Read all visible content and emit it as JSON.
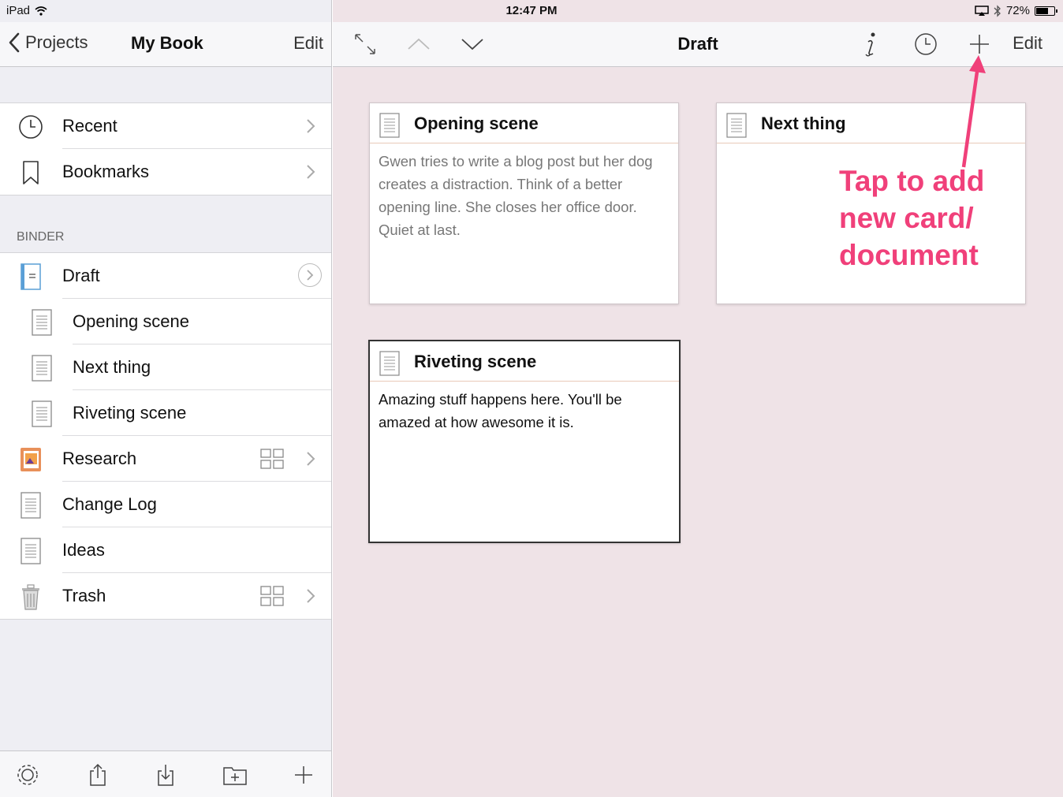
{
  "status": {
    "device": "iPad",
    "time": "12:47 PM",
    "battery": "72%",
    "battery_level": 0.72
  },
  "sidebar": {
    "back_label": "Projects",
    "title": "My Book",
    "edit_label": "Edit",
    "top_items": [
      {
        "label": "Recent",
        "icon": "clock-icon"
      },
      {
        "label": "Bookmarks",
        "icon": "bookmark-icon"
      }
    ],
    "binder_header": "BINDER",
    "binder_items": [
      {
        "label": "Draft",
        "icon": "draft-folder-icon"
      },
      {
        "label": "Opening scene",
        "icon": "document-icon"
      },
      {
        "label": "Next thing",
        "icon": "document-icon"
      },
      {
        "label": "Riveting scene",
        "icon": "document-icon"
      },
      {
        "label": "Research",
        "icon": "research-folder-icon"
      },
      {
        "label": "Change Log",
        "icon": "document-icon"
      },
      {
        "label": "Ideas",
        "icon": "document-icon"
      },
      {
        "label": "Trash",
        "icon": "trash-icon"
      }
    ],
    "toolbar": [
      "settings-gear-icon",
      "share-icon",
      "import-icon",
      "new-folder-icon",
      "add-icon"
    ]
  },
  "main": {
    "title": "Draft",
    "edit_label": "Edit",
    "nav_icons": [
      "expand-icon",
      "chevron-up-icon",
      "chevron-down-icon",
      "info-icon",
      "history-clock-icon",
      "add-icon"
    ],
    "cards": [
      {
        "title": "Opening scene",
        "synopsis": "Gwen tries to write a blog post but her dog creates a distraction. Think of a better opening line. She closes her office door. Quiet at last."
      },
      {
        "title": "Next thing",
        "synopsis": ""
      },
      {
        "title": "Riveting scene",
        "synopsis": "Amazing stuff happens here. You'll be amazed at how awesome it is."
      }
    ]
  },
  "annotation": {
    "line1": "Tap to add",
    "line2": "new card/",
    "line3": "document",
    "color": "#f0407a"
  }
}
